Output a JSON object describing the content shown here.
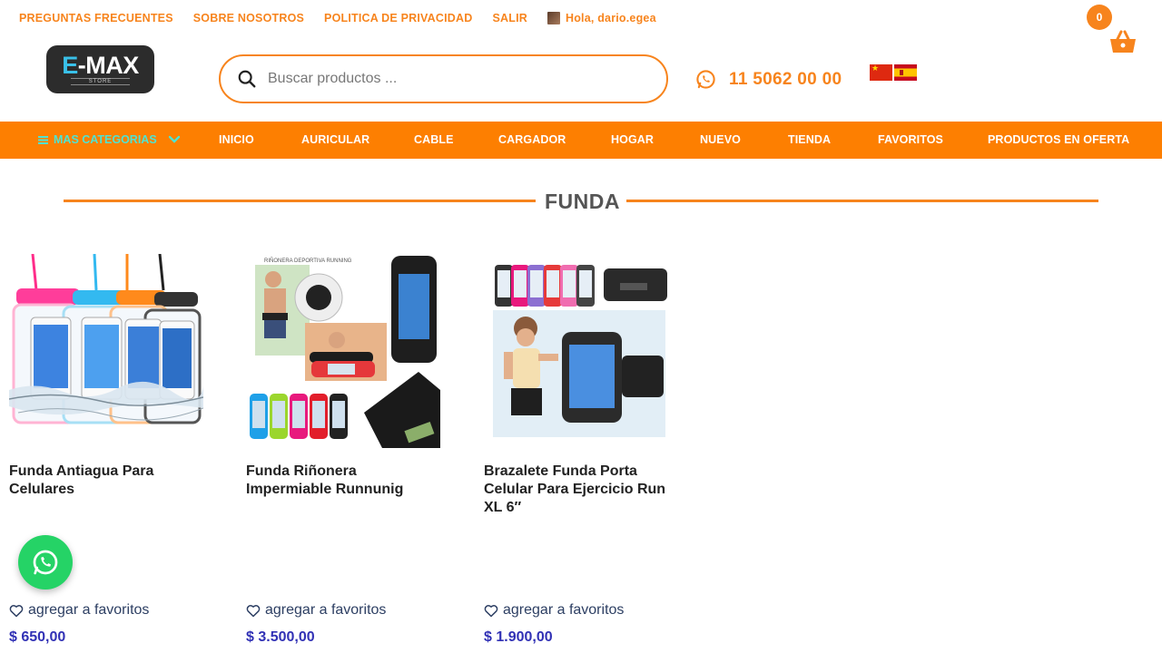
{
  "topbar": {
    "links": [
      "PREGUNTAS FRECUENTES",
      "SOBRE NOSOTROS",
      "POLITICA DE PRIVACIDAD",
      "SALIR"
    ],
    "user_greeting": "Hola, dario.egea"
  },
  "cart": {
    "count": "0"
  },
  "logo": {
    "main_prefix": "E",
    "main_rest": "-MAX",
    "sub": "STORE"
  },
  "search": {
    "placeholder": "Buscar productos ..."
  },
  "contact": {
    "phone": "11 5062 00 00"
  },
  "nav": {
    "categories_label": "MAS CATEGORIAS",
    "items": [
      "INICIO",
      "AURICULAR",
      "CABLE",
      "CARGADOR",
      "HOGAR",
      "NUEVO",
      "TIENDA",
      "FAVORITOS",
      "PRODUCTOS EN OFERTA"
    ]
  },
  "section": {
    "title": "FUNDA"
  },
  "products": [
    {
      "title": "Funda Antiagua Para Celulares",
      "favorite_label": "agregar a favoritos",
      "price": "$ 650,00"
    },
    {
      "title": "Funda Riñonera Impermiable Runnunig",
      "favorite_label": "agregar a favoritos",
      "price": "$ 3.500,00"
    },
    {
      "title": "Brazalete Funda Porta Celular Para Ejercicio Run XL 6″",
      "favorite_label": "agregar a favoritos",
      "price": "$ 1.900,00"
    }
  ],
  "product_image_labels": [
    "RIÑONERA DEPORTIVA RUNNING"
  ],
  "colors": {
    "accent": "#f7841d",
    "nav_bg": "#fd7f01",
    "price": "#3131b5",
    "whatsapp": "#25d366"
  }
}
